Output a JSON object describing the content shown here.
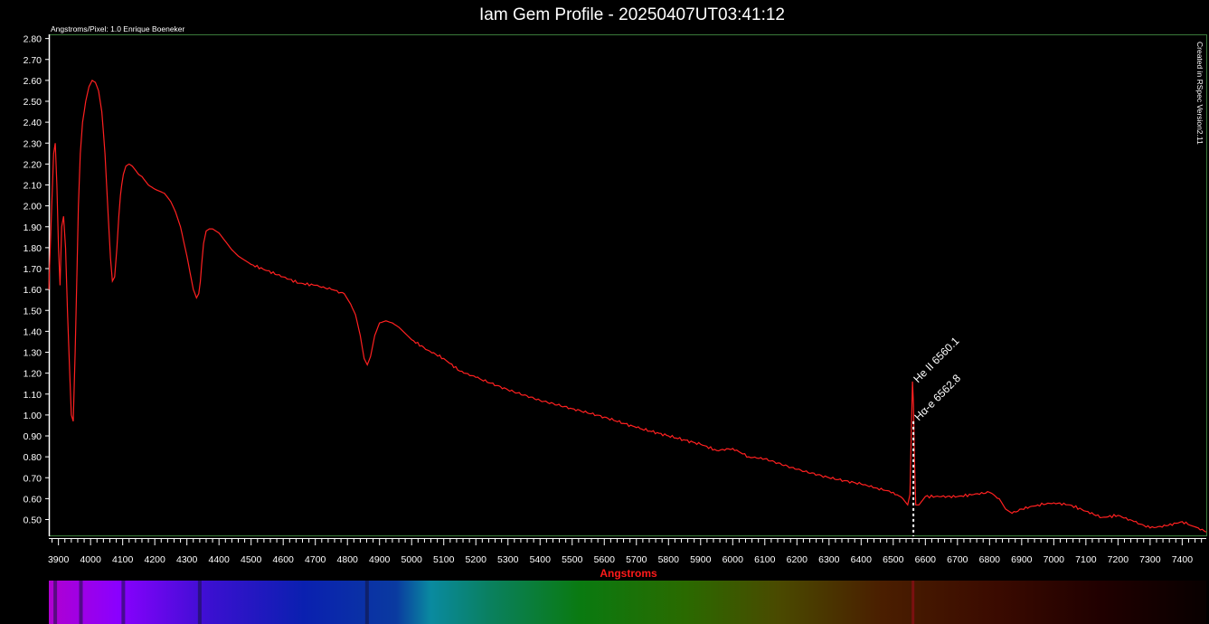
{
  "chart_data": {
    "type": "line",
    "title": "Iam Gem Profile - 20250407UT03:41:12",
    "subtitle": "Angstroms/Pixel: 1.0 Enrique Boeneker",
    "side_note": "Created in RSpec Version2.11",
    "xlabel": "Angstroms",
    "ylabel": "",
    "xlim": [
      3870,
      7475
    ],
    "ylim": [
      0.42,
      2.82
    ],
    "x_ticks": [
      "3900",
      "4000",
      "4100",
      "4200",
      "4300",
      "4400",
      "4500",
      "4600",
      "4700",
      "4800",
      "4900",
      "5000",
      "5100",
      "5200",
      "5300",
      "5400",
      "5500",
      "5600",
      "5700",
      "5800",
      "5900",
      "6000",
      "6100",
      "6200",
      "6300",
      "6400",
      "6500",
      "6600",
      "6700",
      "6800",
      "6900",
      "7000",
      "7100",
      "7200",
      "7300",
      "7400"
    ],
    "y_ticks": [
      "0.50",
      "0.60",
      "0.70",
      "0.80",
      "0.90",
      "1.00",
      "1.10",
      "1.20",
      "1.30",
      "1.40",
      "1.50",
      "1.60",
      "1.70",
      "1.80",
      "1.90",
      "2.00",
      "2.10",
      "2.20",
      "2.30",
      "2.40",
      "2.50",
      "2.60",
      "2.70",
      "2.80"
    ],
    "grid": false,
    "colors": {
      "line": "#ff2020",
      "axis": "#3a7a3a",
      "background": "#000000",
      "xlabel": "#ff1a1a"
    },
    "series": [
      {
        "x": [
          3870,
          3878,
          3885,
          3890,
          3895,
          3900,
          3905,
          3910,
          3916,
          3922,
          3928,
          3935,
          3940,
          3946,
          3952,
          3958,
          3962,
          3968,
          3975,
          3985,
          3995,
          4005,
          4015,
          4025,
          4035,
          4045,
          4055,
          4062,
          4068,
          4075,
          4082,
          4088,
          4093,
          4097,
          4102,
          4110,
          4120,
          4130,
          4140,
          4150,
          4160,
          4170,
          4180,
          4190,
          4200,
          4215,
          4230,
          4250,
          4265,
          4280,
          4290,
          4300,
          4310,
          4320,
          4330,
          4337,
          4342,
          4346,
          4352,
          4360,
          4370,
          4380,
          4390,
          4400,
          4420,
          4440,
          4460,
          4480,
          4500,
          4550,
          4600,
          4650,
          4700,
          4750,
          4790,
          4810,
          4825,
          4840,
          4852,
          4862,
          4872,
          4885,
          4900,
          4920,
          4940,
          4960,
          4980,
          5000,
          5050,
          5100,
          5150,
          5200,
          5300,
          5400,
          5500,
          5600,
          5700,
          5800,
          5900,
          5950,
          6000,
          6050,
          6100,
          6200,
          6300,
          6400,
          6450,
          6500,
          6530,
          6545,
          6552,
          6556,
          6560,
          6563,
          6566,
          6570,
          6580,
          6600,
          6650,
          6700,
          6750,
          6800,
          6830,
          6850,
          6870,
          6900,
          6950,
          7000,
          7050,
          7100,
          7150,
          7200,
          7250,
          7300,
          7350,
          7400,
          7430,
          7450,
          7475
        ],
        "y": [
          1.6,
          1.95,
          2.25,
          2.3,
          2.1,
          1.8,
          1.62,
          1.9,
          1.95,
          1.8,
          1.5,
          1.2,
          1.0,
          0.97,
          1.3,
          1.7,
          2.0,
          2.25,
          2.4,
          2.5,
          2.57,
          2.6,
          2.59,
          2.55,
          2.45,
          2.25,
          1.95,
          1.75,
          1.64,
          1.66,
          1.8,
          1.95,
          2.05,
          2.1,
          2.15,
          2.19,
          2.2,
          2.19,
          2.17,
          2.15,
          2.14,
          2.12,
          2.1,
          2.09,
          2.08,
          2.07,
          2.06,
          2.02,
          1.97,
          1.9,
          1.83,
          1.76,
          1.68,
          1.6,
          1.56,
          1.58,
          1.64,
          1.72,
          1.82,
          1.88,
          1.89,
          1.89,
          1.88,
          1.87,
          1.83,
          1.79,
          1.76,
          1.74,
          1.72,
          1.69,
          1.66,
          1.63,
          1.62,
          1.6,
          1.58,
          1.53,
          1.48,
          1.38,
          1.27,
          1.24,
          1.28,
          1.38,
          1.44,
          1.45,
          1.44,
          1.42,
          1.39,
          1.36,
          1.31,
          1.27,
          1.21,
          1.18,
          1.12,
          1.07,
          1.03,
          0.99,
          0.94,
          0.9,
          0.86,
          0.83,
          0.84,
          0.8,
          0.79,
          0.74,
          0.7,
          0.67,
          0.65,
          0.63,
          0.6,
          0.57,
          0.62,
          0.9,
          1.16,
          1.05,
          0.8,
          0.57,
          0.57,
          0.61,
          0.61,
          0.61,
          0.62,
          0.63,
          0.6,
          0.55,
          0.53,
          0.55,
          0.57,
          0.58,
          0.57,
          0.54,
          0.51,
          0.52,
          0.49,
          0.46,
          0.47,
          0.49,
          0.47,
          0.46,
          0.44
        ]
      }
    ],
    "annotations": [
      {
        "text": "He II 6560.1",
        "x": 6560.1,
        "y": 1.16
      },
      {
        "text": "Hα-e 6562.8",
        "x": 6562.8,
        "y": 0.97
      }
    ],
    "spectrum_strip": true
  }
}
